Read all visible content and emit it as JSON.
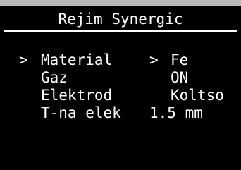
{
  "screen": {
    "title": "Rejim Synergic",
    "cursor": ">",
    "rows": [
      {
        "label": "Material",
        "marker": ">",
        "value": "Fe"
      },
      {
        "label": "Gaz",
        "value": "ON"
      },
      {
        "label": "Elektrod",
        "value": "Koltso"
      },
      {
        "label": "T-na elek",
        "value": "1.5 mm"
      }
    ]
  }
}
